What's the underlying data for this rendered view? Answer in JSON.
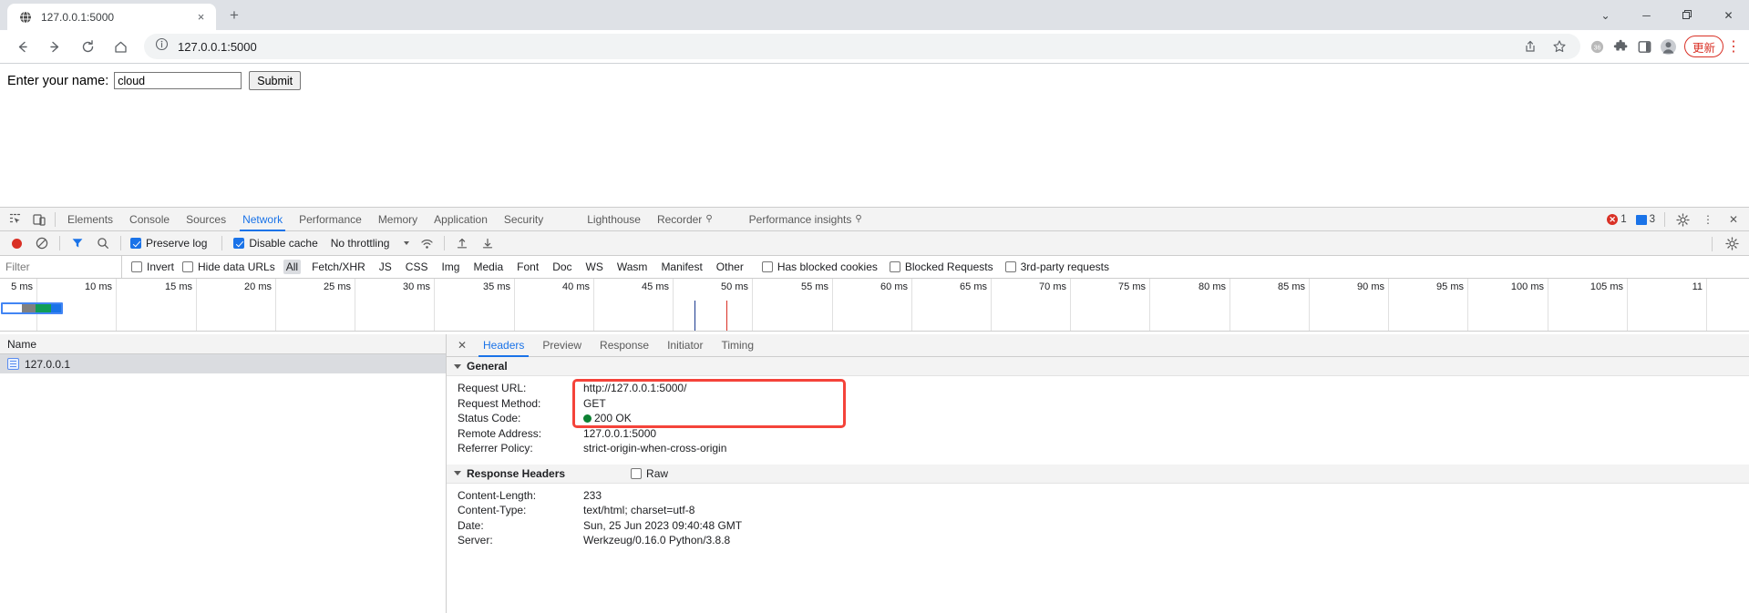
{
  "browser": {
    "tab": {
      "title": "127.0.0.1:5000",
      "favicon": "globe-icon",
      "close": "×"
    },
    "newtab_label": "+",
    "window_controls": {
      "minimize_group": "⌄",
      "minimize": "─",
      "maximize": "❐",
      "close": "✕"
    },
    "nav": {
      "back": "←",
      "forward": "→",
      "reload": "⟳",
      "home": "⌂"
    },
    "omnibox": {
      "info_icon": "info-circle-icon",
      "url": "127.0.0.1:5000"
    },
    "toolbar": {
      "share": "share-icon",
      "bookmark": "star-icon",
      "profile_badge": "coin-icon",
      "extensions": "puzzle-icon",
      "sidepanel": "side-panel-icon",
      "account": "person-icon",
      "update_label": "更新",
      "menu": "⋮"
    }
  },
  "page": {
    "form": {
      "label": "Enter your name:",
      "input_value": "cloud",
      "input_placeholder": "",
      "submit_label": "Submit"
    }
  },
  "devtools": {
    "left_icons": {
      "inspect": "inspect-element-icon",
      "device": "device-toolbar-icon"
    },
    "tabs": [
      {
        "label": "Elements",
        "active": false,
        "badge": ""
      },
      {
        "label": "Console",
        "active": false,
        "badge": ""
      },
      {
        "label": "Sources",
        "active": false,
        "badge": ""
      },
      {
        "label": "Network",
        "active": true,
        "badge": ""
      },
      {
        "label": "Performance",
        "active": false,
        "badge": ""
      },
      {
        "label": "Memory",
        "active": false,
        "badge": ""
      },
      {
        "label": "Application",
        "active": false,
        "badge": ""
      },
      {
        "label": "Security",
        "active": false,
        "badge": ""
      },
      {
        "label": "Lighthouse",
        "active": false,
        "badge": ""
      },
      {
        "label": "Recorder",
        "active": false,
        "badge": "⚲"
      },
      {
        "label": "Performance insights",
        "active": false,
        "badge": "⚲"
      }
    ],
    "status": {
      "error_count": "1",
      "message_count": "3",
      "settings_icon": "gear-icon",
      "more_icon": "⋮",
      "close_icon": "✕"
    },
    "network_toolbar": {
      "record_icon": "record-stop-icon",
      "clear_icon": "clear-icon",
      "filter_icon": "funnel-icon",
      "search_icon": "search-icon",
      "preserve_log": {
        "label": "Preserve log",
        "checked": true
      },
      "disable_cache": {
        "label": "Disable cache",
        "checked": true
      },
      "throttling": "No throttling",
      "wifi_icon": "network-conditions-icon",
      "import_icon": "import-har-icon",
      "export_icon": "export-har-icon",
      "settings_icon": "gear-icon"
    },
    "filter_bar": {
      "filter_placeholder": "Filter",
      "filter_value": "",
      "invert": {
        "label": "Invert",
        "checked": false
      },
      "hide_data_urls": {
        "label": "Hide data URLs",
        "checked": false
      },
      "types": [
        "All",
        "Fetch/XHR",
        "JS",
        "CSS",
        "Img",
        "Media",
        "Font",
        "Doc",
        "WS",
        "Wasm",
        "Manifest",
        "Other"
      ],
      "selected_type": "All",
      "has_blocked_cookies": {
        "label": "Has blocked cookies",
        "checked": false
      },
      "blocked_requests": {
        "label": "Blocked Requests",
        "checked": false
      },
      "third_party": {
        "label": "3rd-party requests",
        "checked": false
      }
    },
    "timeline": {
      "ticks": [
        "5 ms",
        "10 ms",
        "15 ms",
        "20 ms",
        "25 ms",
        "30 ms",
        "35 ms",
        "40 ms",
        "45 ms",
        "50 ms",
        "55 ms",
        "60 ms",
        "65 ms",
        "70 ms",
        "75 ms",
        "80 ms",
        "85 ms",
        "90 ms",
        "95 ms",
        "100 ms",
        "105 ms",
        "11"
      ],
      "segments": [
        {
          "name": "queueing",
          "color": "#ffffff",
          "width_pct": 33
        },
        {
          "name": "stalled",
          "color": "#808080",
          "width_pct": 23
        },
        {
          "name": "waiting",
          "color": "#0f9d58",
          "width_pct": 27
        },
        {
          "name": "download",
          "color": "#1a73e8",
          "width_pct": 17
        }
      ],
      "dom_content_loaded_color": "#1a3a8f",
      "load_color": "#d93025"
    },
    "request_list": {
      "column_header": "Name",
      "rows": [
        {
          "name": "127.0.0.1",
          "icon": "document-icon",
          "selected": true
        }
      ]
    },
    "detail": {
      "close_icon": "✕",
      "tabs": [
        {
          "label": "Headers",
          "active": true
        },
        {
          "label": "Preview",
          "active": false
        },
        {
          "label": "Response",
          "active": false
        },
        {
          "label": "Initiator",
          "active": false
        },
        {
          "label": "Timing",
          "active": false
        }
      ],
      "general": {
        "title": "General",
        "rows": [
          {
            "key": "Request URL:",
            "value": "http://127.0.0.1:5000/",
            "status_dot": false
          },
          {
            "key": "Request Method:",
            "value": "GET",
            "status_dot": false
          },
          {
            "key": "Status Code:",
            "value": "200 OK",
            "status_dot": true
          },
          {
            "key": "Remote Address:",
            "value": "127.0.0.1:5000",
            "status_dot": false
          },
          {
            "key": "Referrer Policy:",
            "value": "strict-origin-when-cross-origin",
            "status_dot": false
          }
        ]
      },
      "response_headers": {
        "title": "Response Headers",
        "raw_label": "Raw",
        "raw_checked": false,
        "rows": [
          {
            "key": "Content-Length:",
            "value": "233"
          },
          {
            "key": "Content-Type:",
            "value": "text/html; charset=utf-8"
          },
          {
            "key": "Date:",
            "value": "Sun, 25 Jun 2023 09:40:48 GMT"
          },
          {
            "key": "Server:",
            "value": "Werkzeug/0.16.0 Python/3.8.8"
          }
        ]
      },
      "annotation": {
        "name": "red-highlight-box",
        "color": "#f4433a"
      }
    }
  }
}
